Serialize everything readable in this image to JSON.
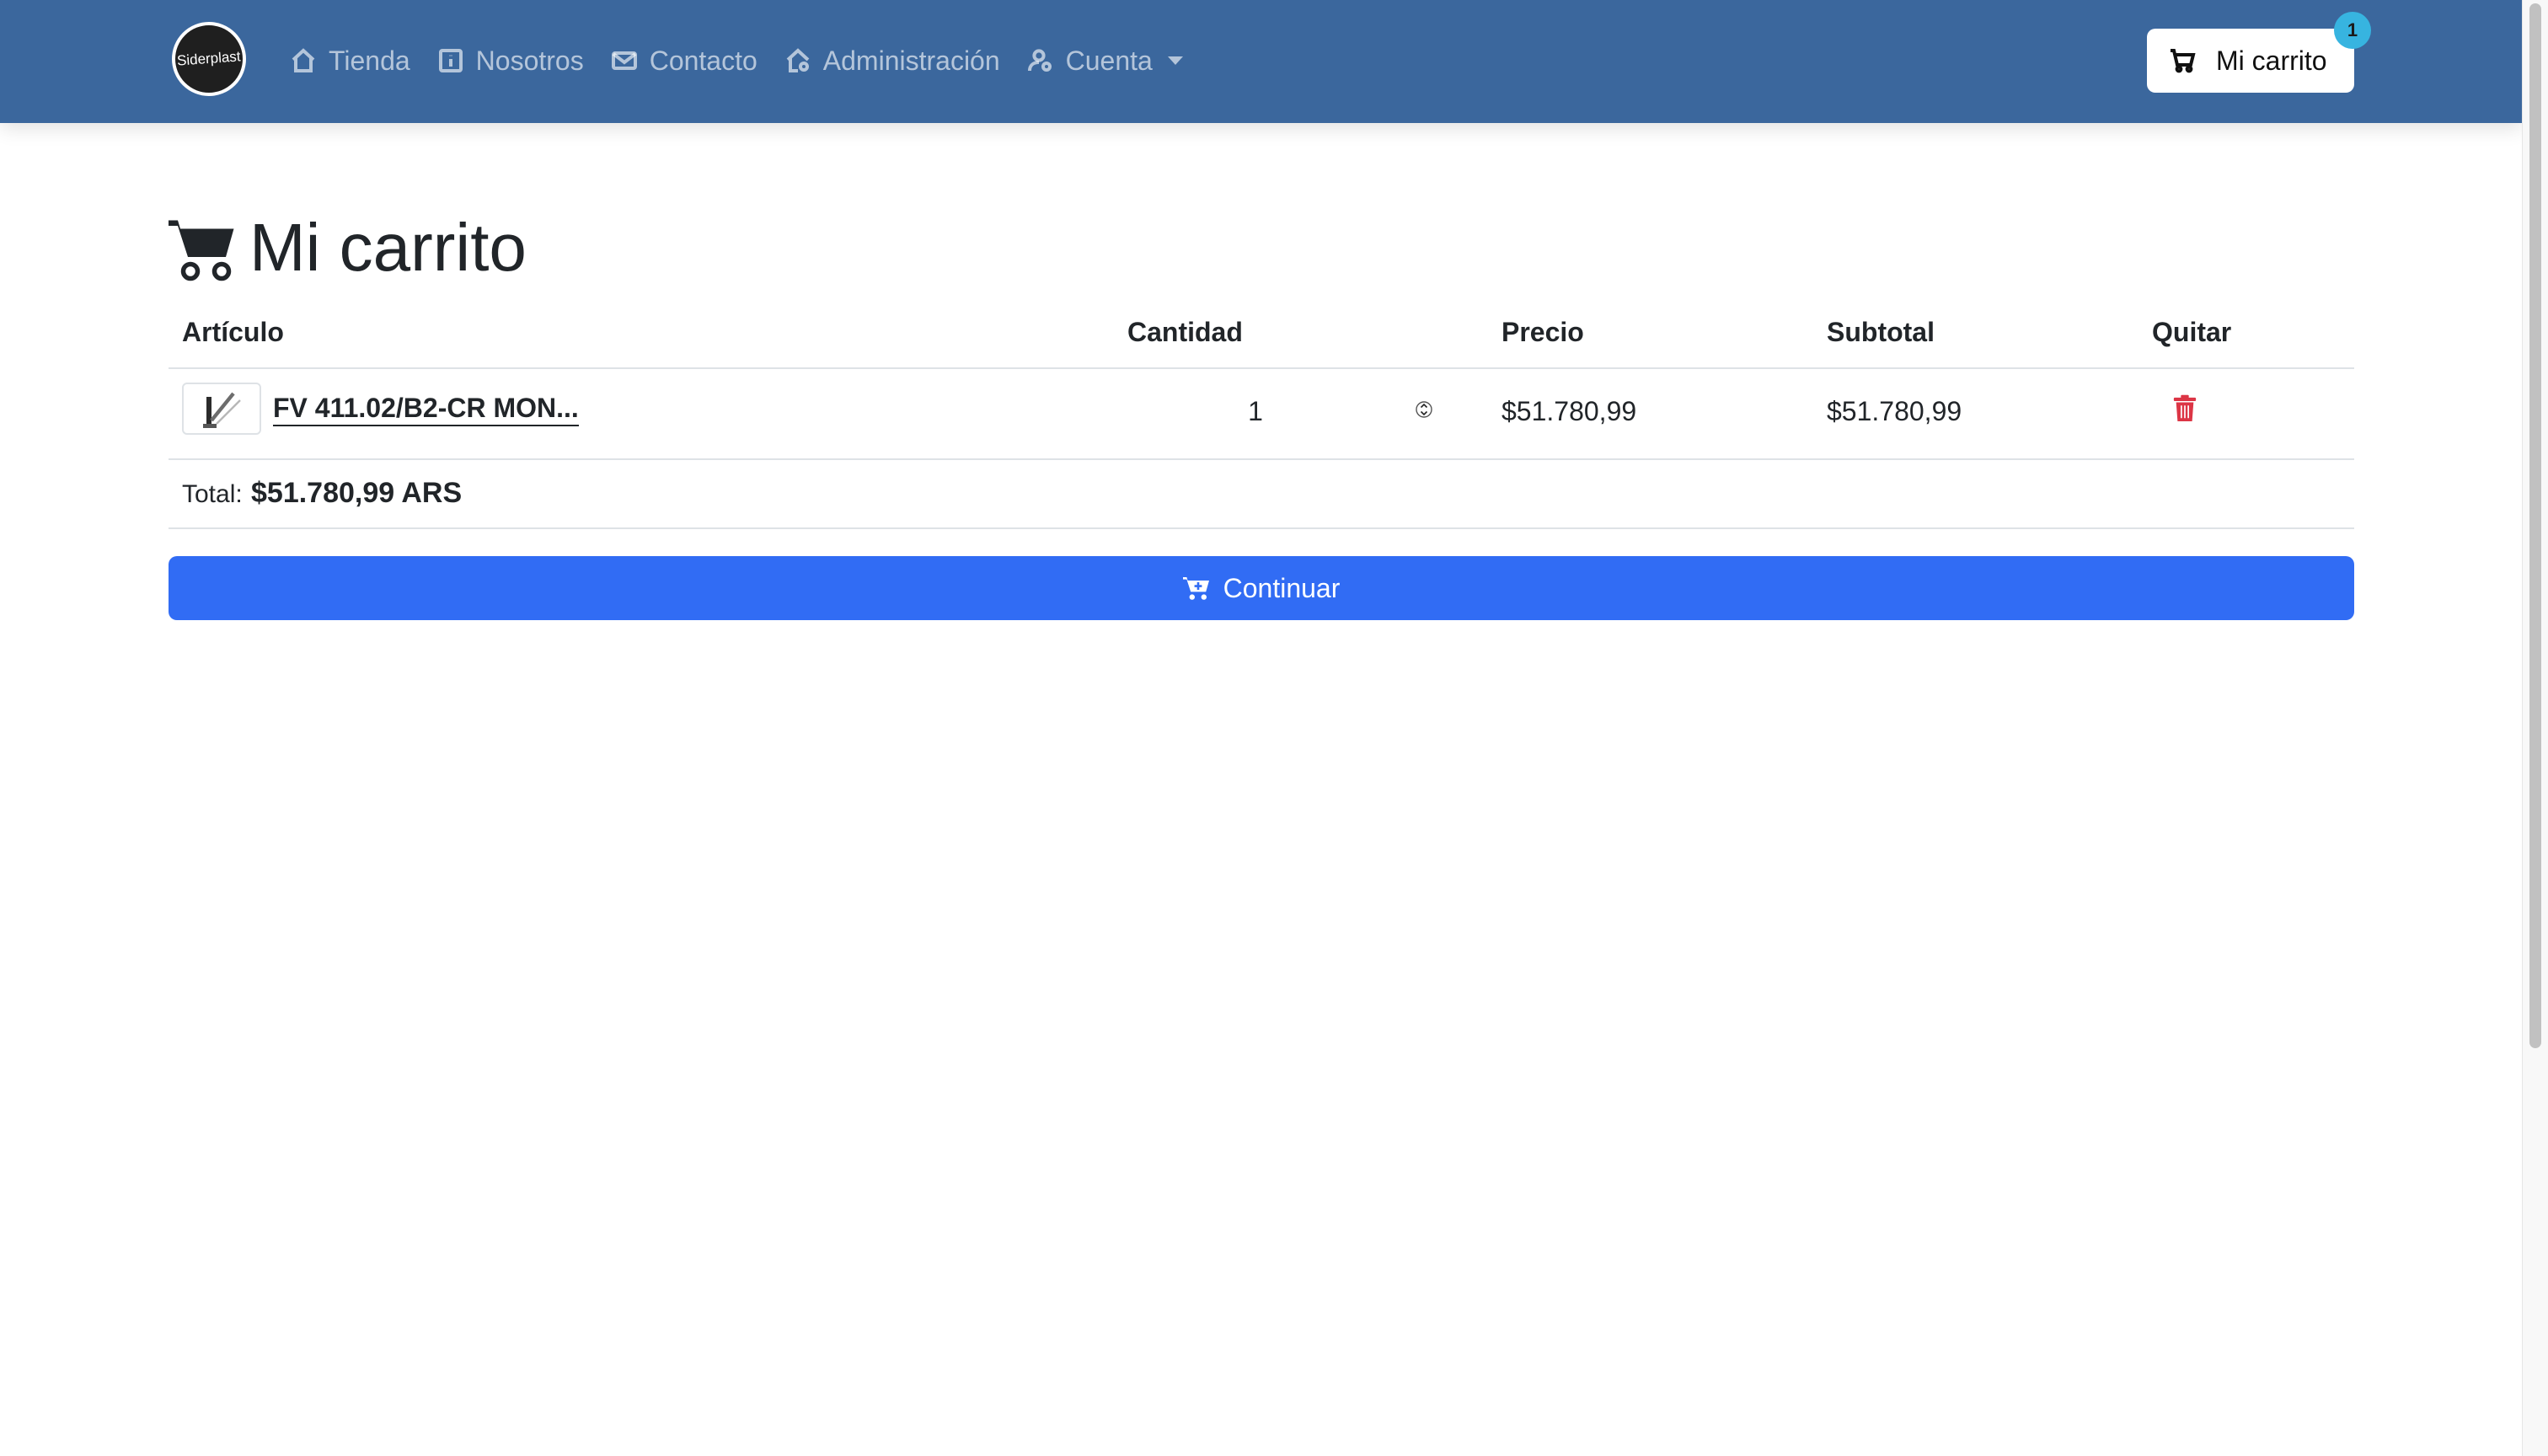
{
  "navbar": {
    "logo_text": "Siderplast",
    "links": [
      {
        "label": "Tienda",
        "icon": "house-icon"
      },
      {
        "label": "Nosotros",
        "icon": "info-square-icon"
      },
      {
        "label": "Contacto",
        "icon": "envelope-icon"
      },
      {
        "label": "Administración",
        "icon": "house-gear-icon"
      },
      {
        "label": "Cuenta",
        "icon": "person-gear-icon"
      }
    ],
    "cart_label": "Mi carrito",
    "cart_count": "1",
    "background_color": "#3b679d"
  },
  "main": {
    "title": "Mi carrito",
    "table": {
      "headers": [
        "Artículo",
        "Cantidad",
        "Precio",
        "Subtotal",
        "Quitar"
      ],
      "rows": [
        {
          "product": "FV 411.02/B2-CR MON...",
          "quantity": "1",
          "price": "$51.780,99",
          "subtotal": "$51.780,99"
        }
      ]
    },
    "total_label": "Total:",
    "total_value": "$51.780,99 ARS",
    "continue_label": "Continuar",
    "accent_color": "#316cf4",
    "danger_color": "#dc3545"
  }
}
